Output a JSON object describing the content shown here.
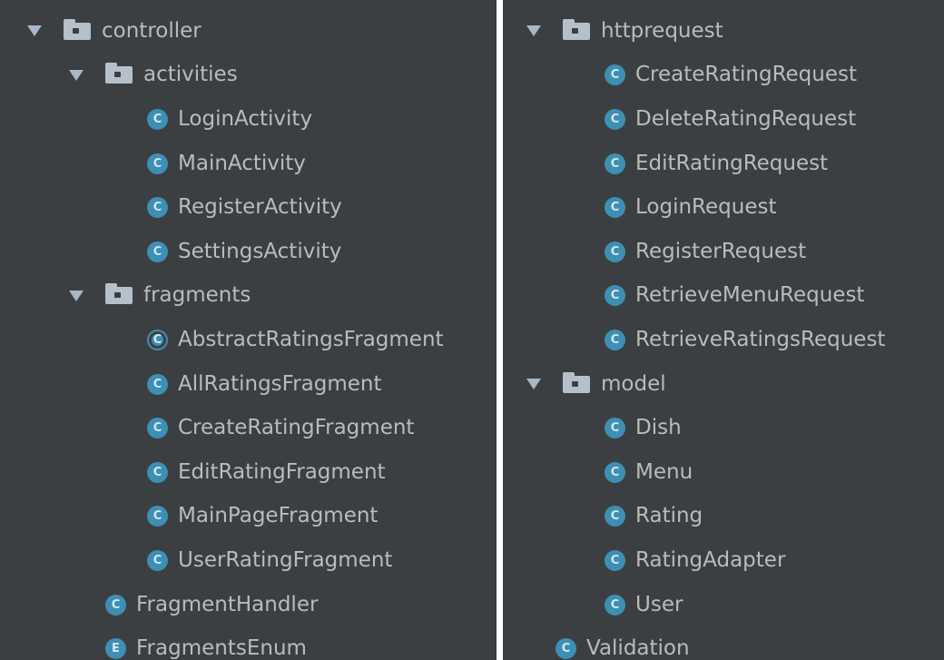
{
  "colors": {
    "panel_bg": "#3c3f41",
    "text": "#bbbbbb",
    "class_icon": "#3d8fb4",
    "folder_icon": "#b6c0cb"
  },
  "icons": {
    "expand": "triangle-down-icon",
    "package": "folder-icon",
    "class": "class-icon",
    "abstract_class": "abstract-class-icon",
    "enum": "enum-icon"
  },
  "left_tree": [
    {
      "type": "package",
      "expanded": true,
      "depth": 0,
      "label": "controller"
    },
    {
      "type": "package",
      "expanded": true,
      "depth": 1,
      "label": "activities"
    },
    {
      "type": "class",
      "depth": 2,
      "letter": "C",
      "label": "LoginActivity"
    },
    {
      "type": "class",
      "depth": 2,
      "letter": "C",
      "label": "MainActivity"
    },
    {
      "type": "class",
      "depth": 2,
      "letter": "C",
      "label": "RegisterActivity"
    },
    {
      "type": "class",
      "depth": 2,
      "letter": "C",
      "label": "SettingsActivity"
    },
    {
      "type": "package",
      "expanded": true,
      "depth": 1,
      "label": "fragments"
    },
    {
      "type": "abstract",
      "depth": 2,
      "letter": "C",
      "label": "AbstractRatingsFragment"
    },
    {
      "type": "class",
      "depth": 2,
      "letter": "C",
      "label": "AllRatingsFragment"
    },
    {
      "type": "class",
      "depth": 2,
      "letter": "C",
      "label": "CreateRatingFragment"
    },
    {
      "type": "class",
      "depth": 2,
      "letter": "C",
      "label": "EditRatingFragment"
    },
    {
      "type": "class",
      "depth": 2,
      "letter": "C",
      "label": "MainPageFragment"
    },
    {
      "type": "class",
      "depth": 2,
      "letter": "C",
      "label": "UserRatingFragment"
    },
    {
      "type": "class",
      "depth": 1,
      "letter": "C",
      "label": "FragmentHandler"
    },
    {
      "type": "enum",
      "depth": 1,
      "letter": "E",
      "label": "FragmentsEnum"
    }
  ],
  "right_tree": [
    {
      "type": "package",
      "expanded": true,
      "depth": 0,
      "label": "httprequest"
    },
    {
      "type": "class",
      "depth": 1,
      "letter": "C",
      "label": "CreateRatingRequest"
    },
    {
      "type": "class",
      "depth": 1,
      "letter": "C",
      "label": "DeleteRatingRequest"
    },
    {
      "type": "class",
      "depth": 1,
      "letter": "C",
      "label": "EditRatingRequest"
    },
    {
      "type": "class",
      "depth": 1,
      "letter": "C",
      "label": "LoginRequest"
    },
    {
      "type": "class",
      "depth": 1,
      "letter": "C",
      "label": "RegisterRequest"
    },
    {
      "type": "class",
      "depth": 1,
      "letter": "C",
      "label": "RetrieveMenuRequest"
    },
    {
      "type": "class",
      "depth": 1,
      "letter": "C",
      "label": "RetrieveRatingsRequest"
    },
    {
      "type": "package",
      "expanded": true,
      "depth": 0,
      "label": "model"
    },
    {
      "type": "class",
      "depth": 1,
      "letter": "C",
      "label": "Dish"
    },
    {
      "type": "class",
      "depth": 1,
      "letter": "C",
      "label": "Menu"
    },
    {
      "type": "class",
      "depth": 1,
      "letter": "C",
      "label": "Rating"
    },
    {
      "type": "class",
      "depth": 1,
      "letter": "C",
      "label": "RatingAdapter"
    },
    {
      "type": "class",
      "depth": 1,
      "letter": "C",
      "label": "User"
    },
    {
      "type": "class",
      "depth": 0,
      "letter": "C",
      "label": "Validation"
    }
  ]
}
